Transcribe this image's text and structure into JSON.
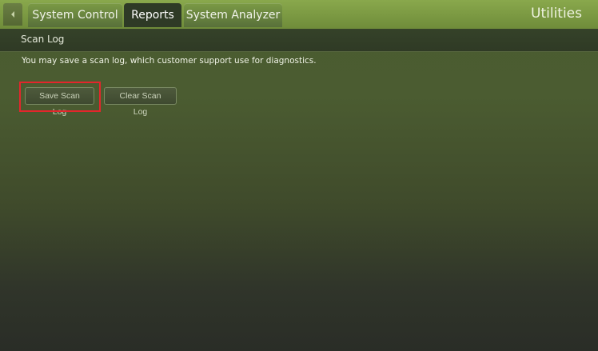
{
  "header": {
    "app_title": "Utilities",
    "tabs": [
      {
        "label": "System Control",
        "active": false
      },
      {
        "label": "Reports",
        "active": true
      },
      {
        "label": "System Analyzer",
        "active": false
      }
    ]
  },
  "section": {
    "title": "Scan Log",
    "description": "You may save a scan log, which customer support use for diagnostics."
  },
  "actions": {
    "save_label": "Save Scan Log",
    "clear_label": "Clear Scan Log"
  },
  "colors": {
    "accent": "#7b9a45",
    "active_tab": "#2e3a26",
    "highlight": "#e3262c"
  }
}
